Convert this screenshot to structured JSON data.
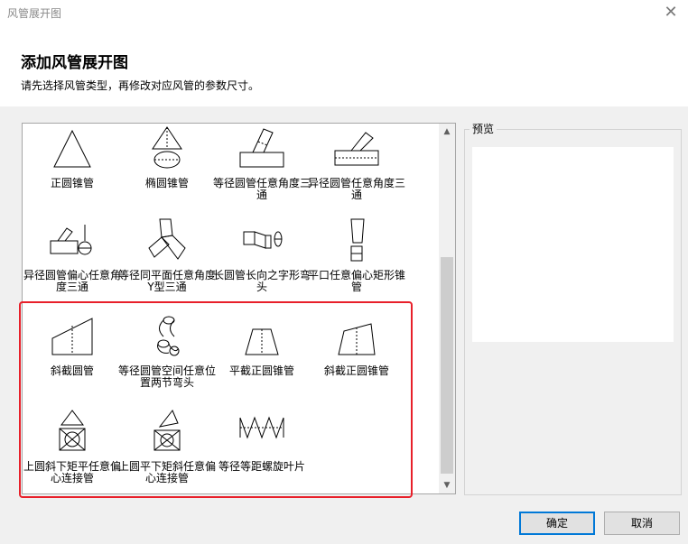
{
  "window": {
    "title": "风管展开图"
  },
  "header": {
    "title": "添加风管展开图",
    "subtitle": "请先选择风管类型，再修改对应风管的参数尺寸。"
  },
  "items": [
    {
      "label": "正圆锥管",
      "icon": "right-cone-icon"
    },
    {
      "label": "椭圆锥管",
      "icon": "oval-cone-icon"
    },
    {
      "label": "等径圆管任意角度三通",
      "icon": "equal-tee-icon"
    },
    {
      "label": "异径圆管任意角度三通",
      "icon": "reducing-tee-icon"
    },
    {
      "label": "异径圆管偏心任意角度三通",
      "icon": "eccentric-tee-icon"
    },
    {
      "label": "等径同平面任意角度Y型三通",
      "icon": "y-tee-icon"
    },
    {
      "label": "长圆管长向之字形弯头",
      "icon": "zigzag-elbow-icon"
    },
    {
      "label": "平口任意偏心矩形锥管",
      "icon": "rect-reducer-icon"
    },
    {
      "label": "斜截圆管",
      "icon": "oblique-pipe-icon"
    },
    {
      "label": "等径圆管空间任意位置两节弯头",
      "icon": "two-piece-elbow-icon"
    },
    {
      "label": "平截正圆锥管",
      "icon": "frustum-icon"
    },
    {
      "label": "斜截正圆锥管",
      "icon": "oblique-frustum-icon"
    },
    {
      "label": "上圆斜下矩平任意偏心连接管",
      "icon": "round-to-rect-icon"
    },
    {
      "label": "上圆平下矩斜任意偏心连接管",
      "icon": "round-to-rect-oblique-icon"
    },
    {
      "label": "等径等距螺旋叶片",
      "icon": "helical-blade-icon"
    }
  ],
  "preview": {
    "label": "预览"
  },
  "buttons": {
    "ok": "确定",
    "cancel": "取消"
  }
}
